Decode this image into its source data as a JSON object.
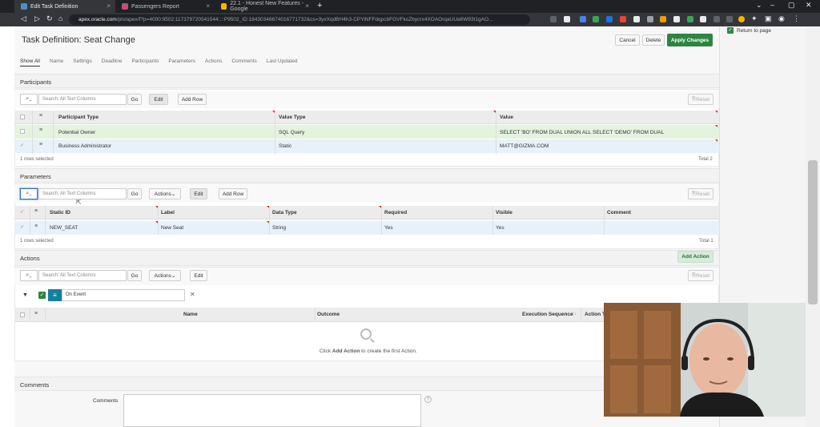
{
  "browser": {
    "tabs": [
      {
        "label": "Edit Task Definition",
        "active": true
      },
      {
        "label": "Passengers Report"
      },
      {
        "label": "22.1 - Honest New Features - Google"
      }
    ],
    "url_host": "apex.oracle.com",
    "url_rest": "/pls/apex/f?p=4000:9502:117379720541544::::P9502_ID:18430346674016771732&cs=3yxXqdBH4h3-CPYiNFFdqpcbFGVFkoZbycrx4XOAOrqaUUa6W93t1gAO...",
    "icons": [
      "back-icon",
      "forward-icon",
      "reload-icon",
      "home-icon",
      "lock-icon",
      "extensions-icon",
      "menu-icon"
    ]
  },
  "right_panel": {
    "return_label": "Return to page"
  },
  "page": {
    "title": "Task Definition: Seat Change",
    "buttons": {
      "cancel": "Cancel",
      "delete": "Delete",
      "apply": "Apply Changes"
    },
    "tabs": [
      "Show All",
      "Name",
      "Settings",
      "Deadline",
      "Participants",
      "Parameters",
      "Actions",
      "Comments",
      "Last Updated"
    ]
  },
  "participants": {
    "title": "Participants",
    "search_placeholder": "Search: All Text Columns",
    "go": "Go",
    "edit": "Edit",
    "add_row": "Add Row",
    "reset": "Reset",
    "columns": [
      "Participant Type",
      "Value Type",
      "Value"
    ],
    "rows": [
      {
        "type": "Potential Owner",
        "value_type": "SQL Query",
        "value": "SELECT 'BO' FROM DUAL UNION ALL SELECT 'DEMO' FROM DUAL"
      },
      {
        "type": "Business Administrator",
        "value_type": "Static",
        "value": "MATT@GIZMA.COM"
      }
    ],
    "footer_left": "1 rows selected",
    "footer_right": "Total 2"
  },
  "parameters": {
    "title": "Parameters",
    "search_placeholder": "Search: All Text Columns",
    "go": "Go",
    "actions": "Actions",
    "edit": "Edit",
    "add_row": "Add Row",
    "reset": "Reset",
    "columns": [
      "Static ID",
      "Label",
      "Data Type",
      "Required",
      "Visible",
      "Comment"
    ],
    "rows": [
      {
        "static_id": "NEW_SEAT",
        "label": "New Seat",
        "data_type": "String",
        "required": "Yes",
        "visible": "Yes",
        "comment": ""
      }
    ],
    "footer_left": "1 rows selected",
    "footer_right": "Total 1"
  },
  "actions_section": {
    "title": "Actions",
    "add_action": "Add Action",
    "search_placeholder": "Search: All Text Columns",
    "go": "Go",
    "actions": "Actions",
    "edit": "Edit",
    "reset": "Reset",
    "filter_label": "On Event",
    "columns": [
      "Name",
      "Outcome",
      "Execution Sequence",
      "Action T"
    ],
    "empty_prefix": "Click ",
    "empty_bold": "Add Action",
    "empty_suffix": " to create the first Action."
  },
  "comments": {
    "title": "Comments",
    "field_label": "Comments"
  }
}
